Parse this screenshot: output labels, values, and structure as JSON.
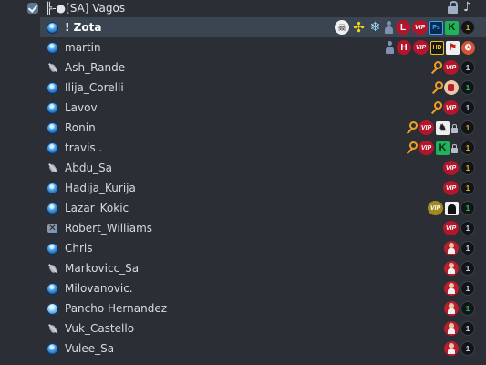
{
  "channel": {
    "name": "╠-●[SA] Vagos",
    "icons": [
      "lock-icon",
      "music-note-icon"
    ]
  },
  "users": [
    {
      "name": "! Zota",
      "bold": true,
      "selected": true,
      "avatar": "talk",
      "badges": [
        "skull",
        "yellow-cross",
        "snowflake",
        "person",
        "L",
        "vip",
        "ps",
        "k",
        "status-gold"
      ]
    },
    {
      "name": "martin",
      "avatar": "talk",
      "badges": [
        "person",
        "H",
        "vip",
        "hd",
        "race",
        "tiger"
      ]
    },
    {
      "name": "Ash_Rande",
      "avatar": "mic-muted",
      "badges": [
        "key",
        "vip",
        "status-white"
      ]
    },
    {
      "name": "Ilija_Corelli",
      "avatar": "talk",
      "badges": [
        "key",
        "rank-key",
        "status-green"
      ]
    },
    {
      "name": "Lavov",
      "avatar": "talk",
      "badges": [
        "key",
        "vip",
        "status-white"
      ]
    },
    {
      "name": "Ronin",
      "avatar": "talk",
      "badges": [
        "key",
        "vip",
        "gang",
        "lock",
        "status-gold"
      ]
    },
    {
      "name": "travis .",
      "avatar": "talk",
      "badges": [
        "key",
        "vip",
        "k",
        "lock",
        "status-gold"
      ]
    },
    {
      "name": "Abdu_Sa",
      "avatar": "mic-muted",
      "badges": [
        "vip",
        "status-gold"
      ]
    },
    {
      "name": "Hadija_Kurija",
      "avatar": "talk",
      "badges": [
        "vip",
        "status-gold"
      ]
    },
    {
      "name": "Lazar_Kokic",
      "avatar": "talk",
      "badges": [
        "vip-gold",
        "portrait",
        "status-green"
      ]
    },
    {
      "name": "Robert_Williams",
      "avatar": "away",
      "badges": [
        "vip",
        "status-white"
      ]
    },
    {
      "name": "Chris",
      "avatar": "talk",
      "badges": [
        "rank-red",
        "status-white"
      ]
    },
    {
      "name": "Markovicc_Sa",
      "avatar": "mic-muted",
      "badges": [
        "rank-red",
        "status-white"
      ]
    },
    {
      "name": "Milovanovic.",
      "avatar": "talk",
      "badges": [
        "rank-red",
        "status-white"
      ]
    },
    {
      "name": "Pancho Hernandez",
      "avatar": "talk-light",
      "badges": [
        "rank-red",
        "status-green"
      ]
    },
    {
      "name": "Vuk_Castello",
      "avatar": "mic-muted",
      "badges": [
        "rank-red",
        "status-white"
      ]
    },
    {
      "name": "Vulee_Sa",
      "avatar": "talk",
      "badges": [
        "rank-red",
        "status-white"
      ]
    }
  ],
  "badge_text": {
    "vip": "VIP",
    "L": "L",
    "H": "H",
    "ps": "Ps",
    "k": "K",
    "hd": "HD",
    "status-gold": "1",
    "status-green": "1",
    "status-white": "1"
  }
}
